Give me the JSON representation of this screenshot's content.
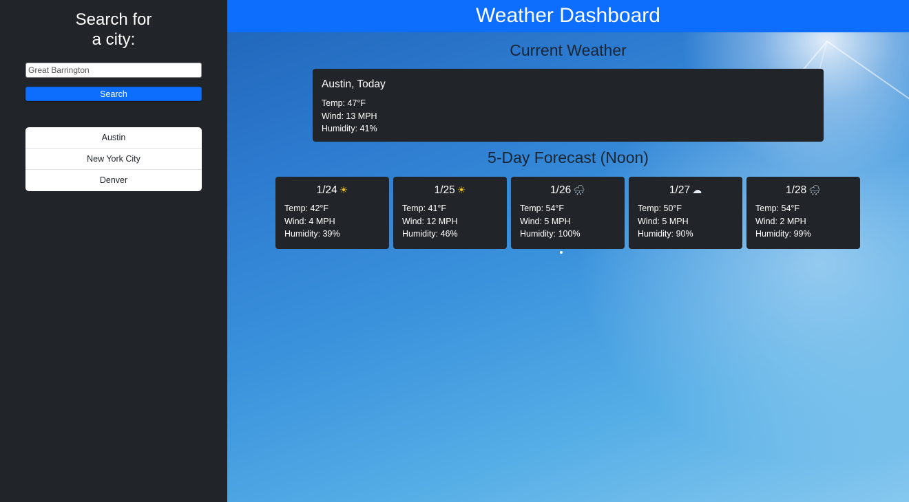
{
  "sidebar": {
    "title_line1": "Search for",
    "title_line2": "a city:",
    "search_value": "Great Barrington",
    "search_button": "Search",
    "history": [
      "Austin",
      "New York City",
      "Denver"
    ]
  },
  "header": {
    "title": "Weather Dashboard"
  },
  "current": {
    "section_title": "Current Weather",
    "city": "Austin, Today",
    "temp": "Temp: 47°F",
    "wind": "Wind: 13 MPH",
    "humidity": "Humidity: 41%"
  },
  "forecast": {
    "section_title": "5-Day Forecast (Noon)",
    "days": [
      {
        "date": "1/24",
        "icon": "sun-icon",
        "glyph": "☀",
        "temp": "Temp: 42°F",
        "wind": "Wind: 4 MPH",
        "humidity": "Humidity: 39%"
      },
      {
        "date": "1/25",
        "icon": "sun-icon",
        "glyph": "☀",
        "temp": "Temp: 41°F",
        "wind": "Wind: 12 MPH",
        "humidity": "Humidity: 46%"
      },
      {
        "date": "1/26",
        "icon": "rain-cloud-icon",
        "glyph": "🌧",
        "temp": "Temp: 54°F",
        "wind": "Wind: 5 MPH",
        "humidity": "Humidity: 100%"
      },
      {
        "date": "1/27",
        "icon": "cloud-icon",
        "glyph": "☁",
        "temp": "Temp: 50°F",
        "wind": "Wind: 5 MPH",
        "humidity": "Humidity: 90%"
      },
      {
        "date": "1/28",
        "icon": "rain-cloud-icon",
        "glyph": "🌧",
        "temp": "Temp: 54°F",
        "wind": "Wind: 2 MPH",
        "humidity": "Humidity: 99%"
      }
    ]
  },
  "colors": {
    "sidebar_bg": "#212529",
    "primary": "#0d6efd",
    "card_bg": "#212529"
  }
}
